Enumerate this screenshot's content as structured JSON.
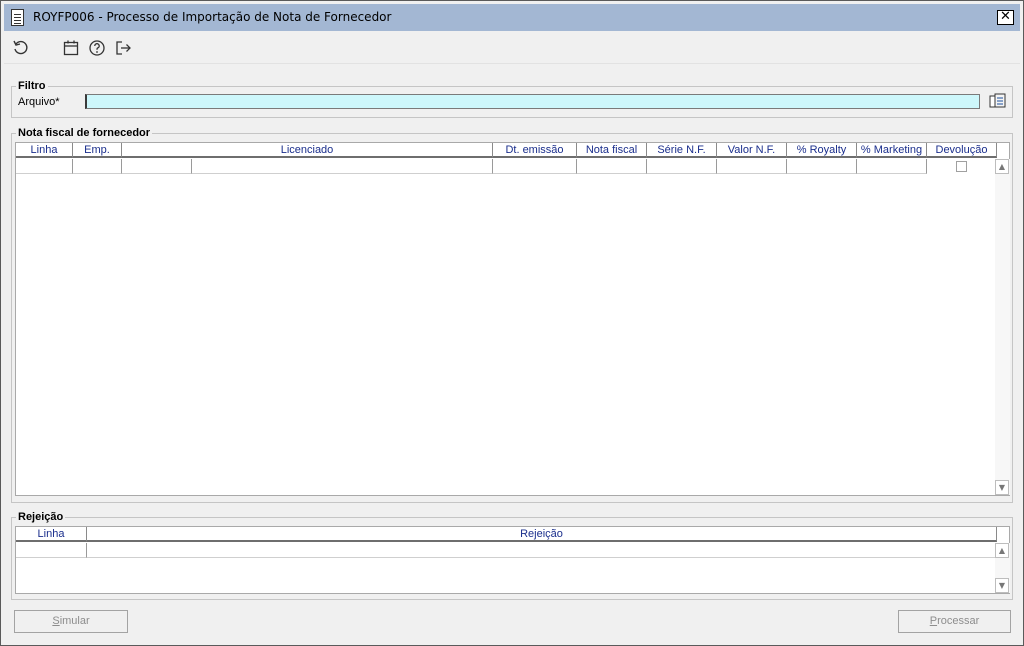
{
  "window": {
    "title": "ROYFP006 - Processo de Importação de Nota de Fornecedor",
    "close_glyph": "✕",
    "icon": "document-icon"
  },
  "toolbar": {
    "icons": [
      "refresh-icon",
      "calendar-icon",
      "help-icon",
      "exit-icon"
    ]
  },
  "filtro": {
    "legend": "Filtro",
    "arquivo_label": "Arquivo*",
    "arquivo_value": "",
    "input_color": "#cdf7fb",
    "browse_icon": "file-browse-icon"
  },
  "nota": {
    "legend": "Nota fiscal de fornecedor",
    "columns": [
      "Linha",
      "Emp.",
      "Licenciado",
      "Dt. emissão",
      "Nota fiscal",
      "Série N.F.",
      "Valor N.F.",
      "% Royalty",
      "% Marketing",
      "Devolução"
    ],
    "header_color": "#1a2e8c"
  },
  "rejeicao": {
    "legend": "Rejeição",
    "columns": [
      "Linha",
      "Rejeição"
    ]
  },
  "buttons": {
    "simular_first": "S",
    "simular_rest": "imular",
    "processar_first": "P",
    "processar_rest": "rocessar"
  }
}
